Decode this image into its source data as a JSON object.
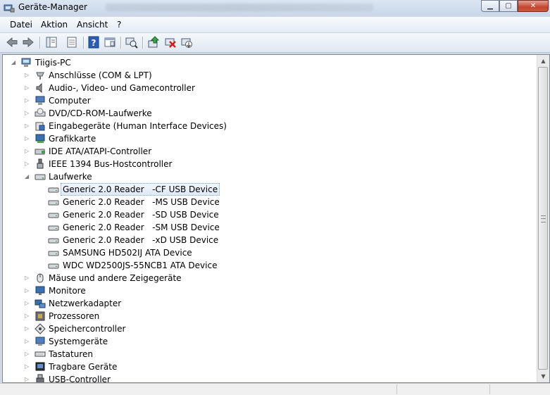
{
  "window": {
    "title": "Geräte-Manager"
  },
  "menu": [
    {
      "label": "Datei"
    },
    {
      "label": "Aktion"
    },
    {
      "label": "Ansicht"
    },
    {
      "label": "?"
    }
  ],
  "tree": {
    "root": "Tiigis-PC",
    "categories": [
      {
        "label": "Anschlüsse (COM & LPT)",
        "icon": "port-icon"
      },
      {
        "label": "Audio-, Video- und Gamecontroller",
        "icon": "speaker-icon"
      },
      {
        "label": "Computer",
        "icon": "computer-icon"
      },
      {
        "label": "DVD/CD-ROM-Laufwerke",
        "icon": "dvd-drive-icon"
      },
      {
        "label": "Eingabegeräte (Human Interface Devices)",
        "icon": "hid-icon"
      },
      {
        "label": "Grafikkarte",
        "icon": "display-adapter-icon"
      },
      {
        "label": "IDE ATA/ATAPI-Controller",
        "icon": "ide-controller-icon"
      },
      {
        "label": "IEEE 1394 Bus-Hostcontroller",
        "icon": "firewire-icon"
      },
      {
        "label": "Laufwerke",
        "icon": "disk-drive-icon",
        "expanded": true,
        "children": [
          {
            "label": "Generic 2.0 Reader   -CF USB Device",
            "selected": true
          },
          {
            "label": "Generic 2.0 Reader   -MS USB Device"
          },
          {
            "label": "Generic 2.0 Reader   -SD USB Device"
          },
          {
            "label": "Generic 2.0 Reader   -SM USB Device"
          },
          {
            "label": "Generic 2.0 Reader   -xD USB Device"
          },
          {
            "label": "SAMSUNG HD502IJ ATA Device"
          },
          {
            "label": "WDC WD2500JS-55NCB1 ATA Device"
          }
        ]
      },
      {
        "label": "Mäuse und andere Zeigegeräte",
        "icon": "mouse-icon"
      },
      {
        "label": "Monitore",
        "icon": "monitor-icon"
      },
      {
        "label": "Netzwerkadapter",
        "icon": "network-adapter-icon"
      },
      {
        "label": "Prozessoren",
        "icon": "processor-icon"
      },
      {
        "label": "Speichercontroller",
        "icon": "storage-controller-icon"
      },
      {
        "label": "Systemgeräte",
        "icon": "system-devices-icon"
      },
      {
        "label": "Tastaturen",
        "icon": "keyboard-icon"
      },
      {
        "label": "Tragbare Geräte",
        "icon": "portable-device-icon"
      },
      {
        "label": "USB-Controller",
        "icon": "usb-icon"
      }
    ]
  },
  "colors": {
    "selection": "#dde9f7",
    "titlebar": "#c9d7e8",
    "close_button": "#c5452f"
  }
}
